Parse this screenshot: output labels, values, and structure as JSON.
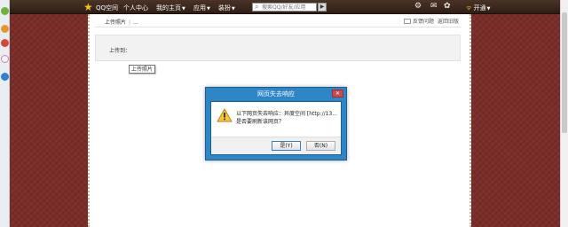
{
  "topbar": {
    "logo_text": "QQ空间",
    "nav": [
      {
        "label": "个人中心",
        "has_arrow": false
      },
      {
        "label": "我的主页",
        "has_arrow": true
      },
      {
        "label": "应用",
        "has_arrow": true
      },
      {
        "label": "装扮",
        "has_arrow": true
      }
    ],
    "search_placeholder": "搜索QQ/好友/应用",
    "open_label": "开通"
  },
  "page": {
    "breadcrumb": [
      "上传照片",
      "..."
    ],
    "feedback_label": "反馈问题",
    "old_version_label": "返回旧版",
    "upload_label": "上传到：",
    "tooltip": "上传照片"
  },
  "dialog": {
    "title": "网页失去响应",
    "message_line1": "以下网页失去响应：异度空间 [http://13...",
    "message_line2": "是否要刷新该网页？",
    "yes_label": "是(Y)",
    "no_label": "否(N)"
  },
  "icons": {
    "logo": "star-icon",
    "search": "search-icon",
    "settings": "gear-icon",
    "mail": "mail-icon",
    "skin": "skin-icon",
    "open": "wifi-icon",
    "warning": "warning-icon",
    "close": "close-icon"
  },
  "colors": {
    "background": "#7a2c27",
    "topbar": "#3a281d",
    "dialog_frame": "#2f86c6",
    "logo_star": "#f5c21a"
  }
}
